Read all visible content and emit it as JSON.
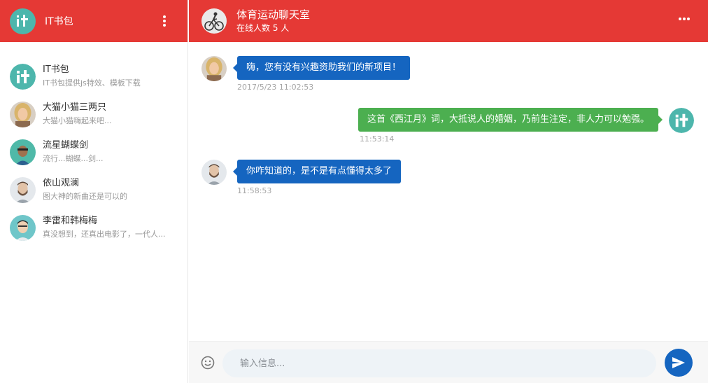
{
  "sidebar": {
    "brand_title": "IT书包",
    "contacts": [
      {
        "name": "IT书包",
        "preview": "IT书包提供js特效、模板下载"
      },
      {
        "name": "大猫小猫三两只",
        "preview": "大猫小猫嗨起来吧..."
      },
      {
        "name": "流星蝴蝶剑",
        "preview": "流行...蝴蝶...剑..."
      },
      {
        "name": "依山观澜",
        "preview": "图大神的新曲还是可以的"
      },
      {
        "name": "李雷和韩梅梅",
        "preview": "真没想到，还真出电影了，一代人..."
      }
    ]
  },
  "chat": {
    "title": "体育运动聊天室",
    "online_count": "在线人数 5 人",
    "messages": [
      {
        "text": "嗨，您有没有兴趣资助我们的新项目！",
        "time": "2017/5/23 11:02:53",
        "side": "left"
      },
      {
        "text": "这首《西江月》词，大抵说人的婚姻，乃前生注定，非人力可以勉强。",
        "time": "11:53:14",
        "side": "right"
      },
      {
        "text": "你咋知道的，是不是有点懂得太多了",
        "time": "11:58:53",
        "side": "left"
      }
    ],
    "input_placeholder": "输入信息..."
  },
  "colors": {
    "header_red": "#e53935",
    "bubble_blue": "#1565c0",
    "bubble_green": "#4caf50",
    "logo_teal": "#4db6ac"
  },
  "icons": {
    "menu": "vertical-dots-icon",
    "more": "horizontal-dots-icon",
    "emoji": "smiley-icon",
    "send": "paper-plane-icon"
  }
}
